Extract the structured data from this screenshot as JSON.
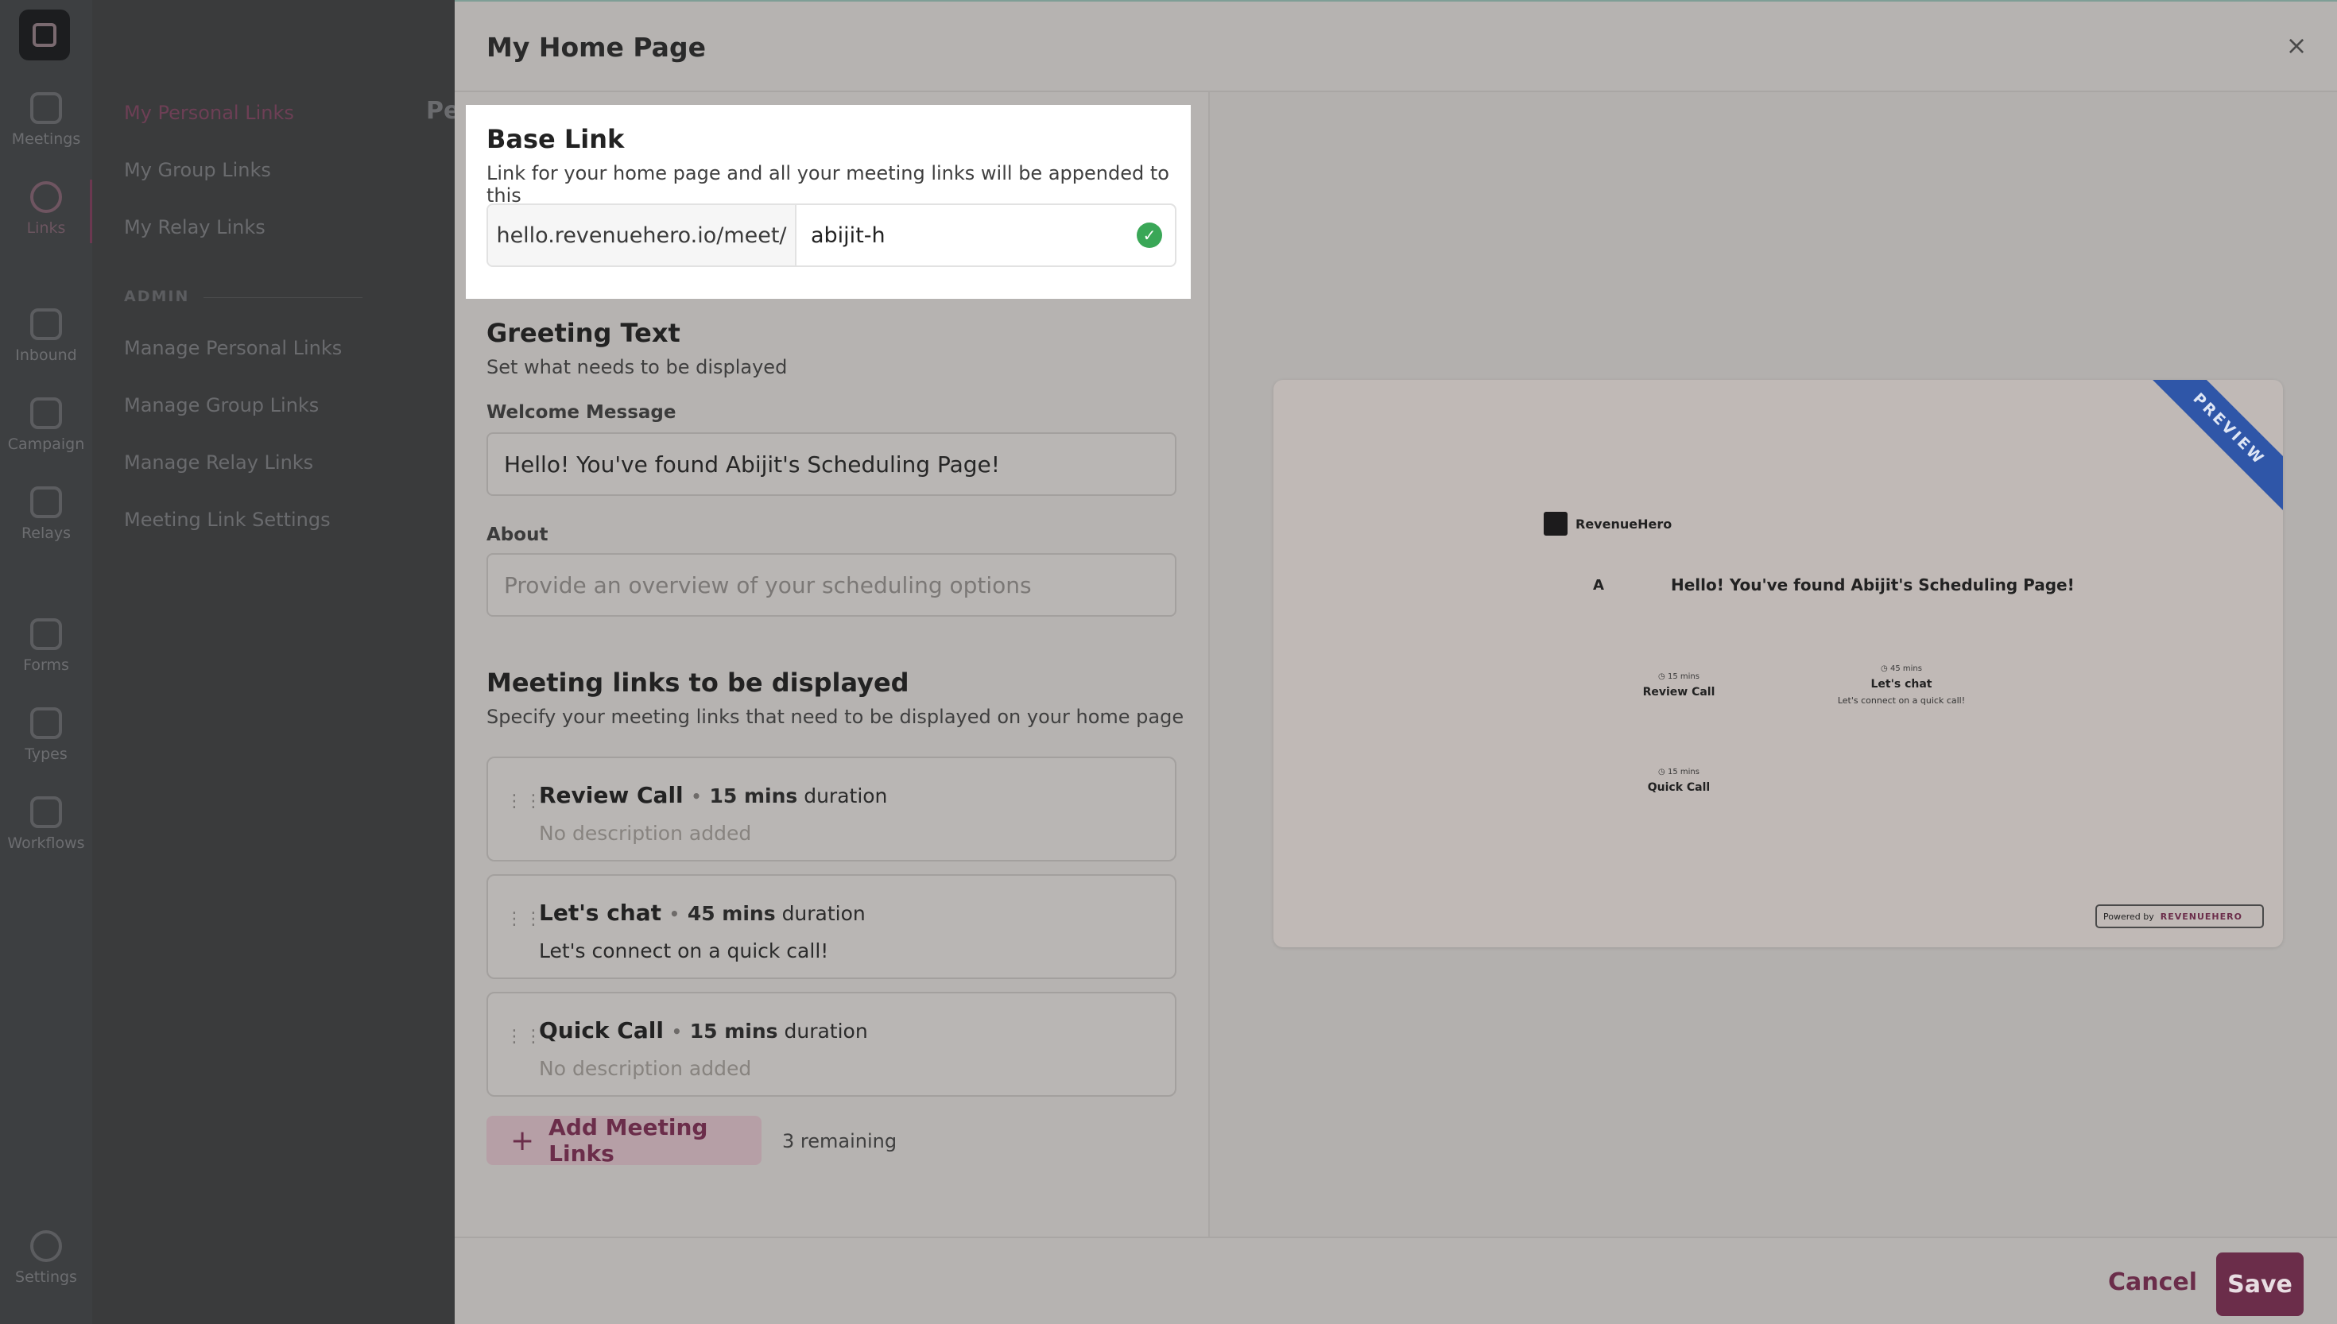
{
  "rail": {
    "items": [
      {
        "label": "Meetings",
        "icon": "calendar-grid-icon"
      },
      {
        "label": "Links",
        "icon": "link-icon"
      },
      {
        "label": "Inbound",
        "icon": "inbound-icon"
      },
      {
        "label": "Campaign",
        "icon": "megaphone-icon"
      },
      {
        "label": "Relays",
        "icon": "relay-icon"
      },
      {
        "label": "Forms",
        "icon": "forms-icon"
      },
      {
        "label": "Types",
        "icon": "types-icon"
      },
      {
        "label": "Workflows",
        "icon": "lightning-icon"
      },
      {
        "label": "Settings",
        "icon": "gear-icon"
      }
    ]
  },
  "subnav": {
    "items": [
      "My Personal Links",
      "My Group Links",
      "My Relay Links"
    ],
    "admin_label": "ADMIN",
    "admin_items": [
      "Manage Personal Links",
      "Manage Group Links",
      "Manage Relay Links",
      "Meeting Link Settings"
    ],
    "page_heading": "Pe"
  },
  "drawer": {
    "title": "My Home Page",
    "close": "×"
  },
  "base_link": {
    "title": "Base Link",
    "subtitle": "Link for your home page and all your meeting links will be appended to this",
    "prefix": "hello.revenuehero.io/meet/",
    "value": "abijit-h"
  },
  "greeting": {
    "title": "Greeting Text",
    "subtitle": "Set what needs to be displayed",
    "welcome_label": "Welcome Message",
    "welcome_value": "Hello! You've found Abijit's Scheduling Page!",
    "about_label": "About",
    "about_placeholder": "Provide an overview of your scheduling options"
  },
  "meeting_links": {
    "title": "Meeting links to be displayed",
    "subtitle": "Specify your meeting links that need to be displayed on your home page",
    "items": [
      {
        "name": "Review Call",
        "duration": "15 mins",
        "suffix": "duration",
        "desc": "No description added"
      },
      {
        "name": "Let's chat",
        "duration": "45 mins",
        "suffix": "duration",
        "desc": "Let's connect on a quick call!"
      },
      {
        "name": "Quick Call",
        "duration": "15 mins",
        "suffix": "duration",
        "desc": "No description added"
      }
    ],
    "add_label": "Add Meeting Links",
    "remaining": "3 remaining"
  },
  "preview": {
    "ribbon": "PREVIEW",
    "brand": "RevenueHero",
    "avatar": "A",
    "greeting": "Hello! You've found Abijit's Scheduling Page!",
    "links": [
      {
        "dur": "15 mins",
        "title": "Review Call",
        "desc": ""
      },
      {
        "dur": "45 mins",
        "title": "Let's chat",
        "desc": "Let's connect on a quick call!"
      },
      {
        "dur": "15 mins",
        "title": "Quick Call",
        "desc": ""
      }
    ],
    "powered_by": "Powered by",
    "powered_brand": "REVENUEHERO"
  },
  "footer": {
    "cancel": "Cancel",
    "save": "Save"
  },
  "colors": {
    "brand": "#6b2d4a",
    "success": "#3aa757",
    "ribbon": "#2f56a8"
  }
}
